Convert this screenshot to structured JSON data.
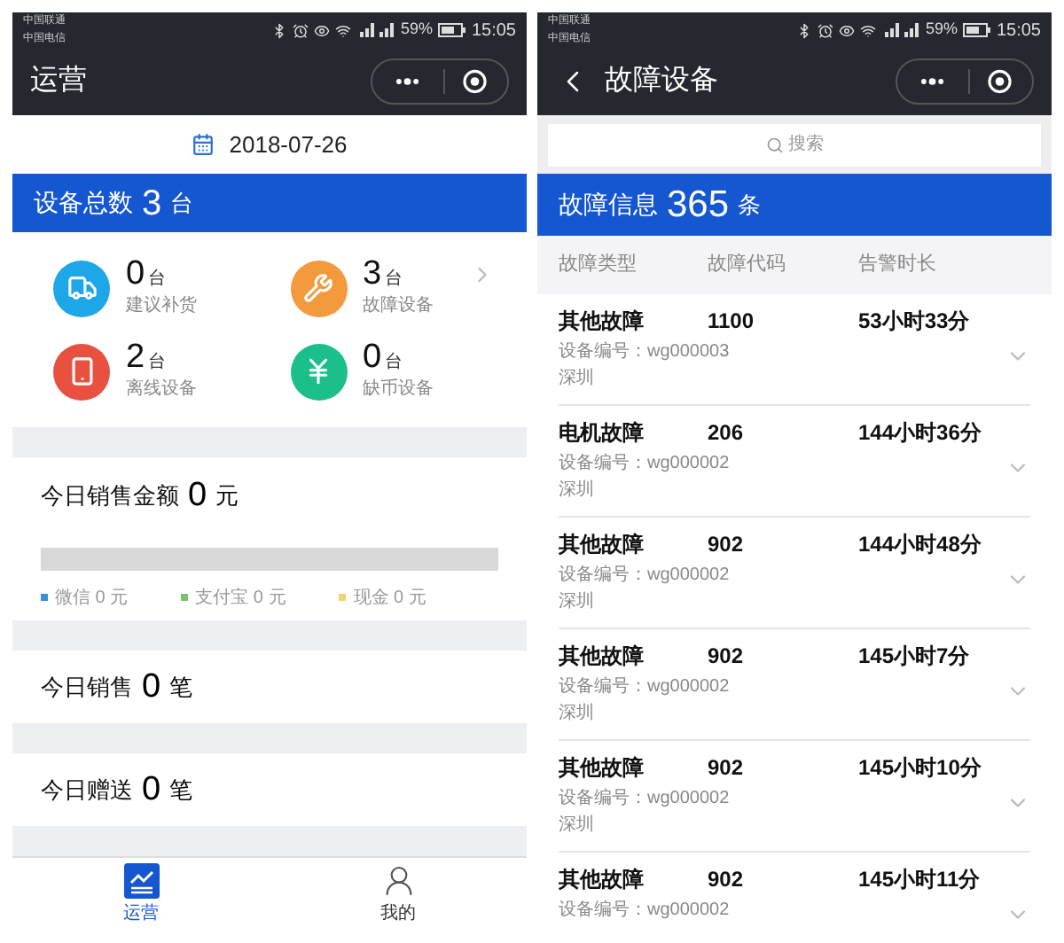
{
  "left_screen": {
    "status_bar": {
      "carriers": [
        "中国联通",
        "中国电信"
      ],
      "battery": "59%",
      "time": "15:05"
    },
    "title": "运营",
    "date": "2018-07-26",
    "total": {
      "label": "设备总数",
      "value": "3",
      "unit": "台"
    },
    "stats": [
      {
        "kind": "truck",
        "value": "0",
        "unit": "台",
        "label": "建议补货",
        "color": "#1ea7e8"
      },
      {
        "kind": "tools",
        "value": "3",
        "unit": "台",
        "label": "故障设备",
        "color": "#f39a3c"
      },
      {
        "kind": "offline",
        "value": "2",
        "unit": "台",
        "label": "离线设备",
        "color": "#e8513f"
      },
      {
        "kind": "coin",
        "value": "0",
        "unit": "台",
        "label": "缺币设备",
        "color": "#1cbf8a"
      }
    ],
    "sales_amount": {
      "label": "今日销售金额",
      "value": "0",
      "unit": "元",
      "legend": [
        {
          "name": "微信",
          "value": "0",
          "unit": "元",
          "color": "#3b8fd6"
        },
        {
          "name": "支付宝",
          "value": "0",
          "unit": "元",
          "color": "#7cc36b"
        },
        {
          "name": "现金",
          "value": "0",
          "unit": "元",
          "color": "#f2d46b"
        }
      ]
    },
    "counters": [
      {
        "label": "今日销售",
        "value": "0",
        "unit": "笔"
      },
      {
        "label": "今日赠送",
        "value": "0",
        "unit": "笔"
      }
    ],
    "tabs": [
      {
        "kind": "chart",
        "label": "运营",
        "selected": true
      },
      {
        "kind": "person",
        "label": "我的",
        "selected": false
      }
    ]
  },
  "right_screen": {
    "status_bar": {
      "carriers": [
        "中国联通",
        "中国电信"
      ],
      "battery": "59%",
      "time": "15:05"
    },
    "title": "故障设备",
    "search": {
      "placeholder": "搜索"
    },
    "total": {
      "label": "故障信息",
      "value": "365",
      "unit": "条"
    },
    "columns": [
      "故障类型",
      "故障代码",
      "告警时长"
    ],
    "rows": [
      {
        "type": "其他故障",
        "code": "1100",
        "duration": "53小时33分",
        "device": "设备编号：wg000003",
        "location": "深圳"
      },
      {
        "type": "电机故障",
        "code": "206",
        "duration": "144小时36分",
        "device": "设备编号：wg000002",
        "location": "深圳"
      },
      {
        "type": "其他故障",
        "code": "902",
        "duration": "144小时48分",
        "device": "设备编号：wg000002",
        "location": "深圳"
      },
      {
        "type": "其他故障",
        "code": "902",
        "duration": "145小时7分",
        "device": "设备编号：wg000002",
        "location": "深圳"
      },
      {
        "type": "其他故障",
        "code": "902",
        "duration": "145小时10分",
        "device": "设备编号：wg000002",
        "location": "深圳"
      },
      {
        "type": "其他故障",
        "code": "902",
        "duration": "145小时11分",
        "device": "设备编号：wg000002"
      }
    ]
  }
}
